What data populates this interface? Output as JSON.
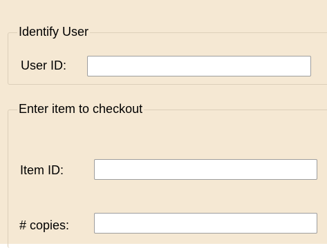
{
  "identify_group": {
    "title": "Identify User",
    "user_id_label": "User ID:",
    "user_id_value": ""
  },
  "checkout_group": {
    "title": "Enter item to checkout",
    "item_id_label": "Item ID:",
    "item_id_value": "",
    "copies_label": "# copies:",
    "copies_value": ""
  },
  "colors": {
    "panel_background": "#f5e8d3",
    "group_border": "#dccfb9",
    "field_border": "#9d9d9d",
    "field_background": "#ffffff"
  }
}
